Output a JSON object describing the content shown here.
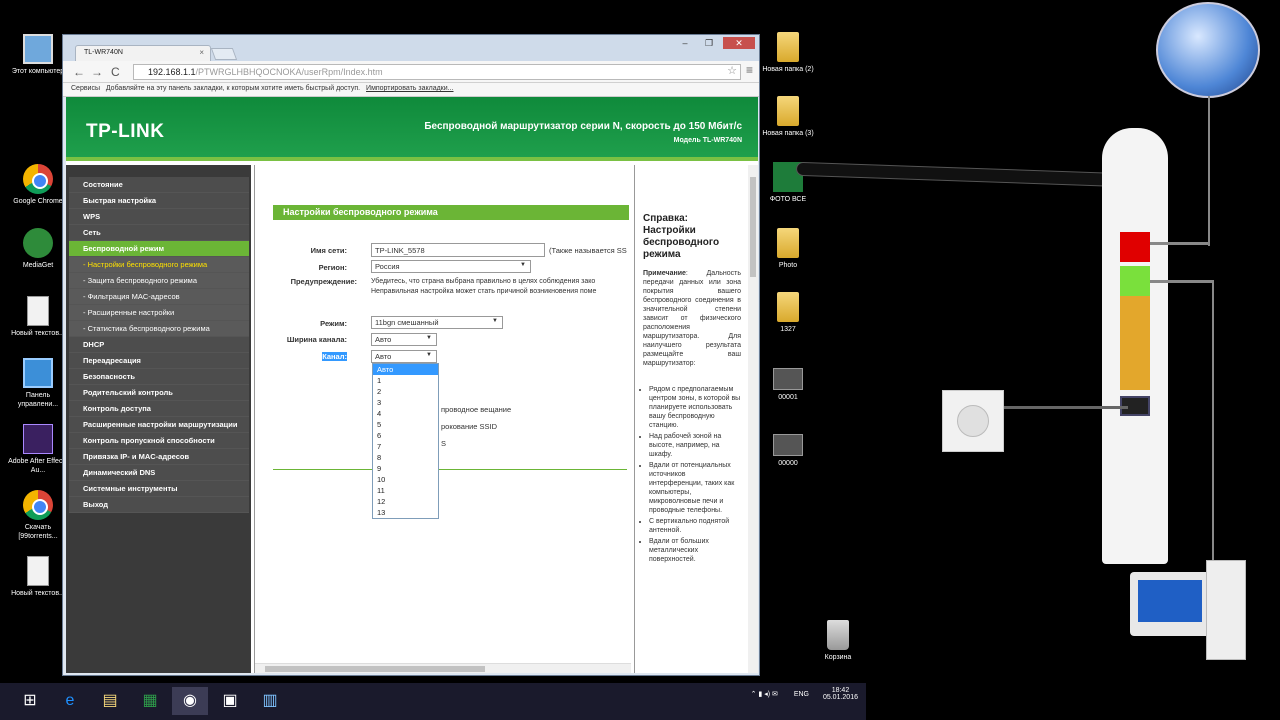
{
  "desktop": {
    "left_icons": [
      "Этот компьютер",
      "Google Chrome",
      "MediaGet",
      "Новый текстов...",
      "Панель управлени...",
      "Adobe After Effects Au...",
      "Скачать [99torrents...",
      "Новый текстов..."
    ],
    "right_icons": [
      "Новая папка (2)",
      "Новая папка (3)",
      "ФОТО ВСЕ",
      "Photo",
      "1327",
      "00001",
      "00000",
      "Корзина"
    ]
  },
  "browser": {
    "tab_title": "TL-WR740N",
    "tab_close": "×",
    "btn_min": "‒",
    "btn_max": "❐",
    "btn_close": "✕",
    "back": "←",
    "forward": "→",
    "reload": "C",
    "url_host": "192.168.1.1",
    "url_path": "/PTWRGLHBHQOCNOKA/userRpm/Index.htm",
    "star": "☆",
    "menu": "≡",
    "bookmarks_prefix": "Сервисы",
    "bookmarks_text": "Добавляйте на эту панель закладки, к которым хотите иметь быстрый доступ.",
    "bookmarks_link": "Импортировать закладки..."
  },
  "router_page": {
    "logo": "TP-LINK",
    "banner_title": "Беспроводной маршрутизатор серии N, скорость до 150 Мбит/с",
    "banner_model": "Модель TL-WR740N",
    "menu": [
      {
        "label": "Состояние"
      },
      {
        "label": "Быстрая настройка"
      },
      {
        "label": "WPS"
      },
      {
        "label": "Сеть"
      },
      {
        "label": "Беспроводной режим"
      },
      {
        "label": "- Настройки беспроводного режима"
      },
      {
        "label": "- Защита беспроводного режима"
      },
      {
        "label": "- Фильтрация MAC-адресов"
      },
      {
        "label": "- Расширенные настройки"
      },
      {
        "label": "- Статистика беспроводного режима"
      },
      {
        "label": "DHCP"
      },
      {
        "label": "Переадресация"
      },
      {
        "label": "Безопасность"
      },
      {
        "label": "Родительский контроль"
      },
      {
        "label": "Контроль доступа"
      },
      {
        "label": "Расширенные настройки маршрутизации"
      },
      {
        "label": "Контроль пропускной способности"
      },
      {
        "label": "Привязка IP- и MAC-адресов"
      },
      {
        "label": "Динамический DNS"
      },
      {
        "label": "Системные инструменты"
      },
      {
        "label": "Выход"
      }
    ],
    "section_title": "Настройки беспроводного режима",
    "ssid_label": "Имя сети:",
    "ssid_value": "TP-LINK_5578",
    "ssid_note": "(Также называется SS",
    "region_label": "Регион:",
    "region_value": "Россия",
    "warning_label": "Предупреждение:",
    "warning_line1": "Убедитесь, что страна выбрана правильно в целях соблюдения зако",
    "warning_line2": "Неправильная настройка может стать причиной возникновения поме",
    "mode_label": "Режим:",
    "mode_value": "11bgn смешанный",
    "width_label": "Ширина канала:",
    "width_value": "Авто",
    "channel_label": "Канал:",
    "channel_value": "Авто",
    "channel_options": [
      "Авто",
      "1",
      "2",
      "3",
      "4",
      "5",
      "6",
      "7",
      "8",
      "9",
      "10",
      "11",
      "12",
      "13"
    ],
    "behind_1": "проводное вещание",
    "behind_2": "рокование SSID",
    "behind_3": "S",
    "help_title": "Справка: Настройки беспроводного режима",
    "help_note_label": "Примечание",
    "help_note": ": Дальность передачи данных или зона покрытия вашего беспроводного соединения в значительной степени зависит от физического расположения маршрутизатора. Для наилучшего результата размещайте ваш маршрутизатор:",
    "help_items": [
      "Рядом с предполагаемым центром зоны, в которой вы планируете использовать вашу беспроводную станцию.",
      "Над рабочей зоной на высоте, например, на шкафу.",
      "Вдали от потенциальных источников интерференции, таких как компьютеры, микроволновые печи и проводные телефоны.",
      "С вертикально поднятой антенной.",
      "Вдали от больших металлических поверхностей."
    ]
  },
  "taskbar": {
    "lang": "ENG",
    "time": "18:42",
    "date": "05.01.2016"
  }
}
